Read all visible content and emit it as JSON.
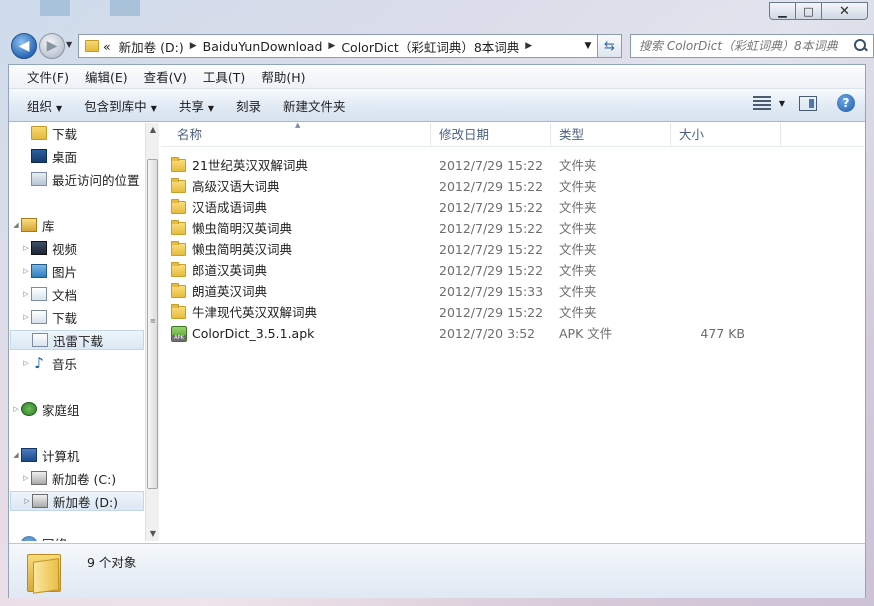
{
  "window": {
    "caption": {
      "minimize": "▁",
      "maximize": "□",
      "close": "✕"
    }
  },
  "nav": {
    "back": "◀",
    "forward": "▶",
    "breadcrumb_overflow": "«",
    "breadcrumb": [
      "新加卷 (D:)",
      "BaiduYunDownload",
      "ColorDict（彩虹词典）8本词典"
    ],
    "refresh": "⇆",
    "search_placeholder": "搜索 ColorDict（彩虹词典）8本词典"
  },
  "menubar": [
    "文件(F)",
    "编辑(E)",
    "查看(V)",
    "工具(T)",
    "帮助(H)"
  ],
  "commands": {
    "organize": "组织",
    "include_in_library": "包含到库中",
    "share": "共享",
    "burn": "刻录",
    "new_folder": "新建文件夹",
    "help": "?"
  },
  "navpane": {
    "downloads": "下载",
    "desktop": "桌面",
    "recent": "最近访问的位置",
    "libraries": "库",
    "videos": "视频",
    "pictures": "图片",
    "documents": "文档",
    "lib_downloads": "下载",
    "thunder": "迅雷下载",
    "music": "音乐",
    "homegroup": "家庭组",
    "computer": "计算机",
    "drive_c": "新加卷 (C:)",
    "drive_d": "新加卷 (D:)",
    "network": "网络"
  },
  "columns": {
    "name": "名称",
    "date": "修改日期",
    "type": "类型",
    "size": "大小"
  },
  "files": [
    {
      "name": "21世纪英汉双解词典",
      "date": "2012/7/29 15:22",
      "type": "文件夹",
      "size": "",
      "icon": "folder-icon"
    },
    {
      "name": "高级汉语大词典",
      "date": "2012/7/29 15:22",
      "type": "文件夹",
      "size": "",
      "icon": "folder-icon"
    },
    {
      "name": "汉语成语词典",
      "date": "2012/7/29 15:22",
      "type": "文件夹",
      "size": "",
      "icon": "folder-icon"
    },
    {
      "name": "懒虫简明汉英词典",
      "date": "2012/7/29 15:22",
      "type": "文件夹",
      "size": "",
      "icon": "folder-icon"
    },
    {
      "name": "懒虫简明英汉词典",
      "date": "2012/7/29 15:22",
      "type": "文件夹",
      "size": "",
      "icon": "folder-icon"
    },
    {
      "name": "郎道汉英词典",
      "date": "2012/7/29 15:22",
      "type": "文件夹",
      "size": "",
      "icon": "folder-icon"
    },
    {
      "name": "朗道英汉词典",
      "date": "2012/7/29 15:33",
      "type": "文件夹",
      "size": "",
      "icon": "folder-icon"
    },
    {
      "name": "牛津现代英汉双解词典",
      "date": "2012/7/29 15:22",
      "type": "文件夹",
      "size": "",
      "icon": "folder-icon"
    },
    {
      "name": "ColorDict_3.5.1.apk",
      "date": "2012/7/20 3:52",
      "type": "APK 文件",
      "size": "477 KB",
      "icon": "apk-icon"
    }
  ],
  "details": {
    "count_text": "9 个对象"
  }
}
